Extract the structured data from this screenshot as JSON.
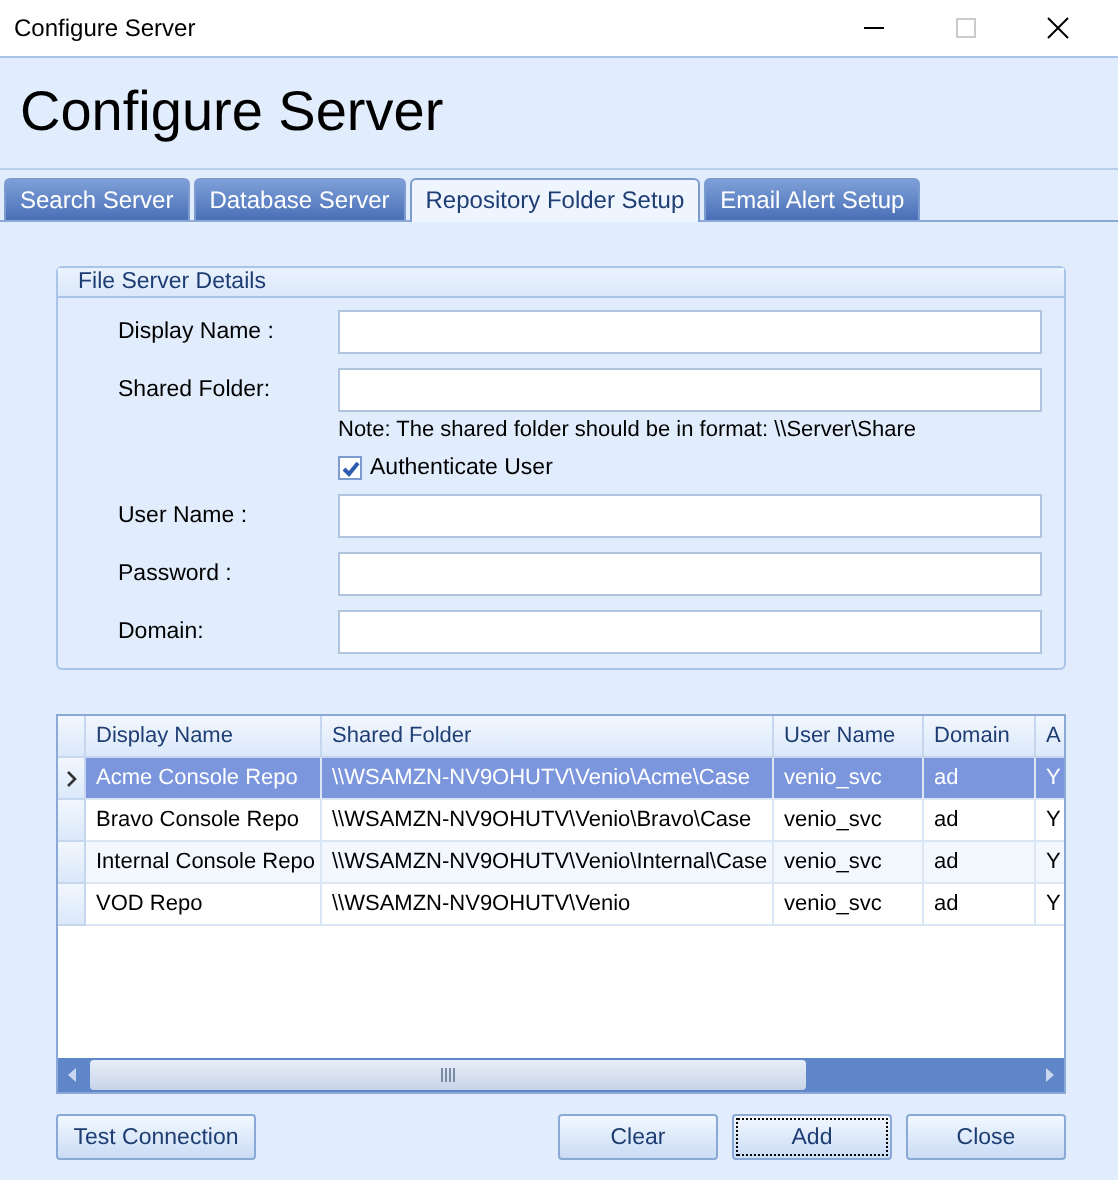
{
  "window": {
    "title": "Configure Server"
  },
  "header": {
    "title": "Configure Server"
  },
  "tabs": [
    {
      "label": "Search Server",
      "selected": false
    },
    {
      "label": "Database Server",
      "selected": false
    },
    {
      "label": "Repository Folder Setup",
      "selected": true
    },
    {
      "label": "Email Alert Setup",
      "selected": false
    }
  ],
  "group": {
    "title": "File Server Details",
    "fields": [
      {
        "kind": "input",
        "label": "Display Name :"
      },
      {
        "kind": "input",
        "label": "Shared Folder:"
      },
      {
        "kind": "note",
        "text": "Note: The shared folder should be in format: \\\\Server\\Share"
      },
      {
        "kind": "checkbox",
        "label": "Authenticate User",
        "checked": true
      },
      {
        "kind": "input",
        "label": "User Name :"
      },
      {
        "kind": "input",
        "label": "Password :"
      },
      {
        "kind": "input",
        "label": "Domain:"
      }
    ]
  },
  "table": {
    "columns": [
      "Display Name",
      "Shared Folder",
      "User Name",
      "Domain",
      "A"
    ],
    "rows": [
      {
        "selected": true,
        "cells": [
          "Acme Console Repo",
          "\\\\WSAMZN-NV9OHUTV\\Venio\\Acme\\Case",
          "venio_svc",
          "ad",
          "Y"
        ]
      },
      {
        "selected": false,
        "cells": [
          "Bravo Console Repo",
          "\\\\WSAMZN-NV9OHUTV\\Venio\\Bravo\\Case",
          "venio_svc",
          "ad",
          "Y"
        ]
      },
      {
        "selected": false,
        "cells": [
          "Internal Console Repo",
          "\\\\WSAMZN-NV9OHUTV\\Venio\\Internal\\Case",
          "venio_svc",
          "ad",
          "Y"
        ]
      },
      {
        "selected": false,
        "cells": [
          "VOD Repo",
          "\\\\WSAMZN-NV9OHUTV\\Venio",
          "venio_svc",
          "ad",
          "Y"
        ]
      }
    ]
  },
  "buttons": [
    {
      "label": "Test Connection",
      "focused": false
    },
    {
      "label": "Clear",
      "focused": false
    },
    {
      "label": "Add",
      "focused": true
    },
    {
      "label": "Close",
      "focused": false
    }
  ]
}
